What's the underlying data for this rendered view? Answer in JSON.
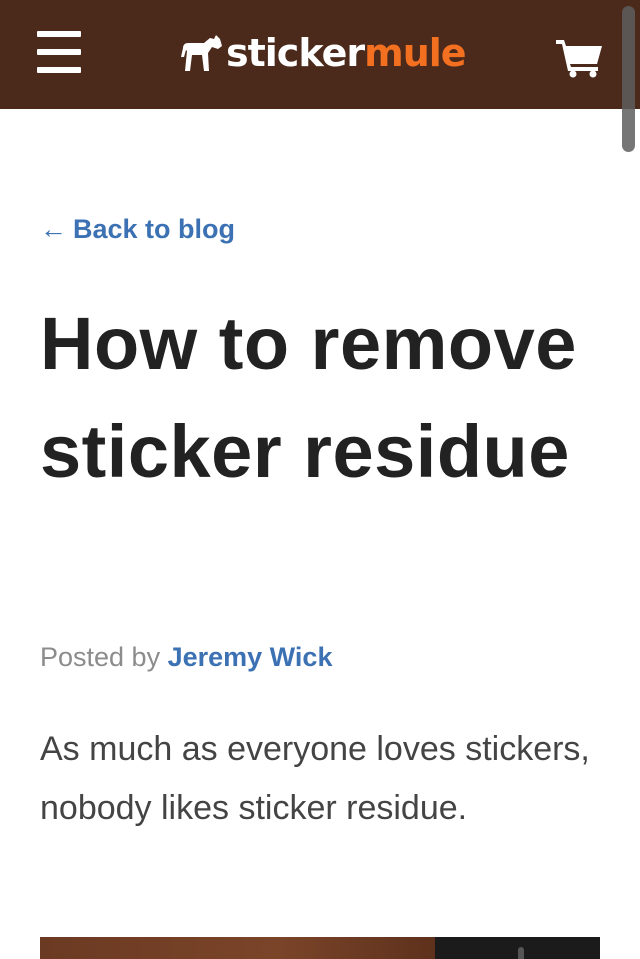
{
  "header": {
    "logo": {
      "part1": "sticker",
      "part2": "mule"
    },
    "menu_icon": "hamburger-icon",
    "cart_icon": "cart-icon"
  },
  "colors": {
    "header_bg": "#4b2a1b",
    "accent": "#f37021",
    "link": "#3c72b3",
    "title": "#222222",
    "body_text": "#444444",
    "meta_text": "#8c8c8c"
  },
  "article": {
    "back_arrow": "←",
    "back_label": "Back to blog",
    "title": "How to remove sticker residue",
    "byline_prefix": "Posted by",
    "author": "Jeremy Wick",
    "intro": "As much as everyone loves stickers, nobody likes sticker residue."
  }
}
